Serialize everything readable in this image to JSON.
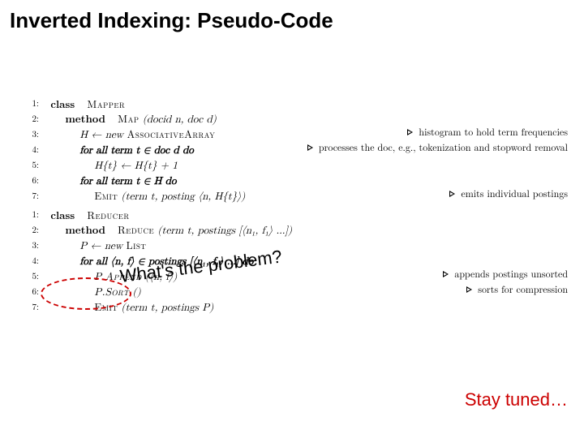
{
  "title": "Inverted Indexing: Pseudo-Code",
  "mapper": {
    "ln1": "1:",
    "ln2": "2:",
    "ln3": "3:",
    "ln4": "4:",
    "ln5": "5:",
    "ln6": "6:",
    "ln7": "7:",
    "class": "class",
    "name": "Mapper",
    "method": "method",
    "method_name": "Map",
    "method_args": "(docid n, doc d)",
    "h_new": "H ← new ",
    "assoc": "AssociativeArray",
    "c3": "histogram to hold term frequencies",
    "for1": "for all term t ∈ doc d do",
    "c4": "processes the doc, e.g., tokenization and stopword removal",
    "h_inc": "H{t} ← H{t} + 1",
    "for2": "for all term t ∈ H do",
    "emit": "Emit",
    "emit_args": "(term t, posting ⟨n, H{t}⟩)",
    "c7": "emits individual postings"
  },
  "reducer": {
    "ln1": "1:",
    "ln2": "2:",
    "ln3": "3:",
    "ln4": "4:",
    "ln5": "5:",
    "ln6": "6:",
    "ln7": "7:",
    "class": "class",
    "name": "Reducer",
    "method": "method",
    "method_name": "Reduce",
    "method_args": "(term t, postings [⟨n₁, f₁⟩ …])",
    "p_new": "P ← new ",
    "list": "List",
    "for": "for all ⟨n, f⟩ ∈ postings [⟨n₁, f₁⟩ …] do",
    "append": "P.Append",
    "append_args": "(⟨n, f⟩)",
    "c5": "appends postings unsorted",
    "sort": "P.Sort",
    "sort_args": "()",
    "c6": "sorts for compression",
    "emit": "Emit",
    "emit_args": "(term t, postings P)"
  },
  "callout": "What's the problem?",
  "footer": "Stay tuned…"
}
